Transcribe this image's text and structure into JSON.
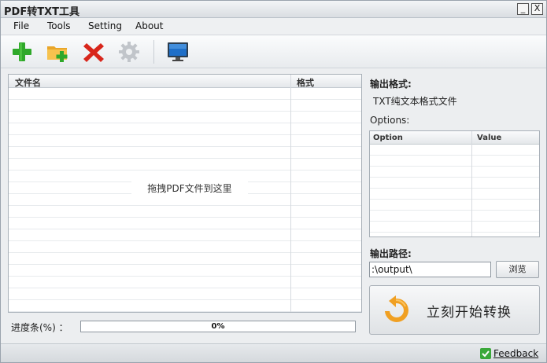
{
  "window": {
    "title": "PDF转TXT工具",
    "minimize_glyph": "_",
    "close_glyph": "X"
  },
  "menu": {
    "items": [
      "File",
      "Tools",
      "Setting",
      "About"
    ]
  },
  "toolbar": {
    "buttons": [
      {
        "icon": "add-icon",
        "color": "#2fa82a"
      },
      {
        "icon": "add-folder-icon",
        "color": "#e9a62a"
      },
      {
        "icon": "delete-icon",
        "color": "#d8261b"
      },
      {
        "icon": "settings-icon",
        "color": "#b7bcc2"
      },
      {
        "icon": "monitor-icon",
        "color": "#1f6fc8"
      }
    ]
  },
  "file_list": {
    "columns": [
      "文件名",
      "格式"
    ],
    "drop_hint": "拖拽PDF文件到这里"
  },
  "progress": {
    "label": "进度条(%) ：",
    "value": 0,
    "text": "0%"
  },
  "output_format": {
    "label": "输出格式:",
    "value": "TXT纯文本格式文件"
  },
  "options": {
    "label": "Options:",
    "columns": [
      "Option",
      "Value"
    ]
  },
  "output_path": {
    "label": "输出路径:",
    "value": ":\\output\\",
    "browse_label": "浏览"
  },
  "start_button": {
    "label": "立刻开始转换",
    "icon_color": "#f0a023"
  },
  "status": {
    "feedback_label": "Feedback"
  }
}
